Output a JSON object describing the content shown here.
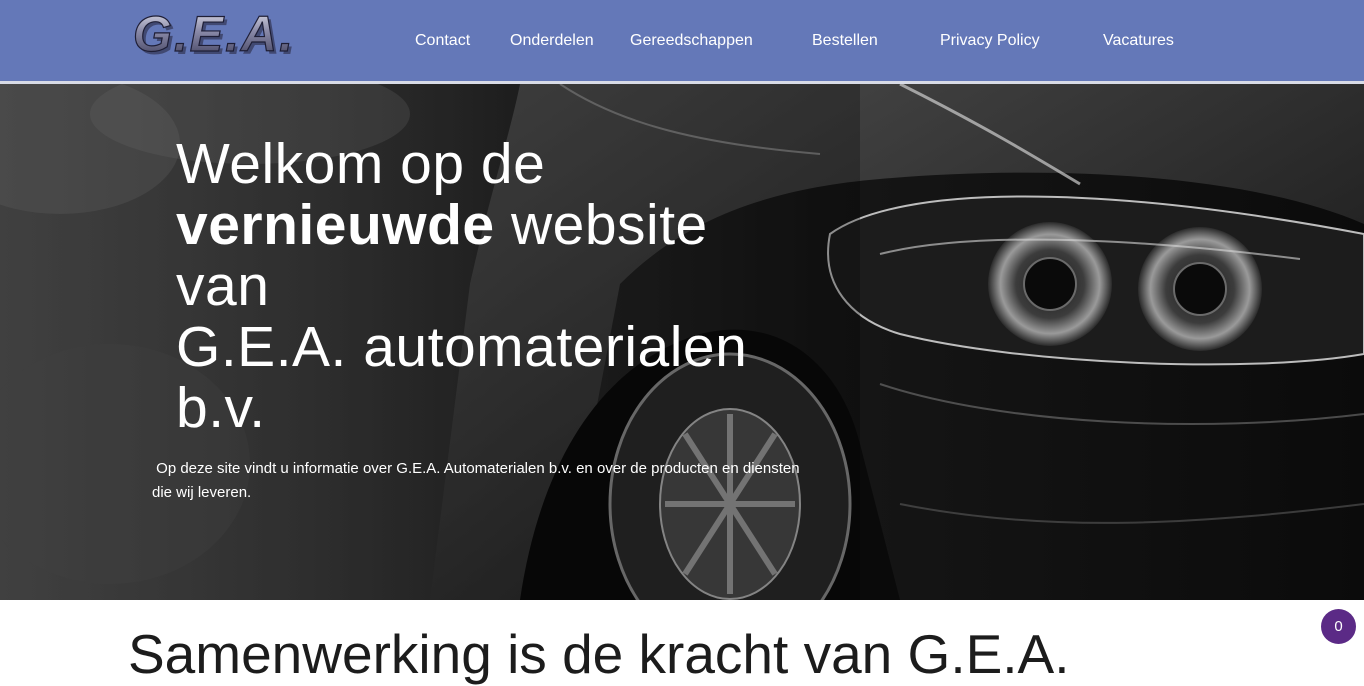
{
  "header": {
    "logo_text": "G.E.A.",
    "nav": [
      {
        "label": "Contact"
      },
      {
        "label": "Onderdelen"
      },
      {
        "label": "Gereedschappen"
      },
      {
        "label": "Bestellen"
      },
      {
        "label": "Privacy Policy"
      },
      {
        "label": "Vacatures"
      }
    ]
  },
  "hero": {
    "title_line1": "Welkom op de",
    "title_bold1": "vernieuwde",
    "title_line2_rest": " website van",
    "title_line3": "G.E.A. automaterialen",
    "title_line4": "b.v.",
    "intro_line1": " Op deze site vindt u informatie over G.E.A. Automaterialen b.v. en over de producten en diensten",
    "intro_line2": "die wij leveren."
  },
  "section": {
    "title": "Samenwerking is de kracht van G.E.A."
  },
  "cart": {
    "count": "0"
  },
  "colors": {
    "header_bg": "#6478b8",
    "cart_badge": "#5b2a86",
    "hero_text": "#ffffff"
  },
  "icons": [
    "logo-image",
    "car-headlight-image"
  ]
}
